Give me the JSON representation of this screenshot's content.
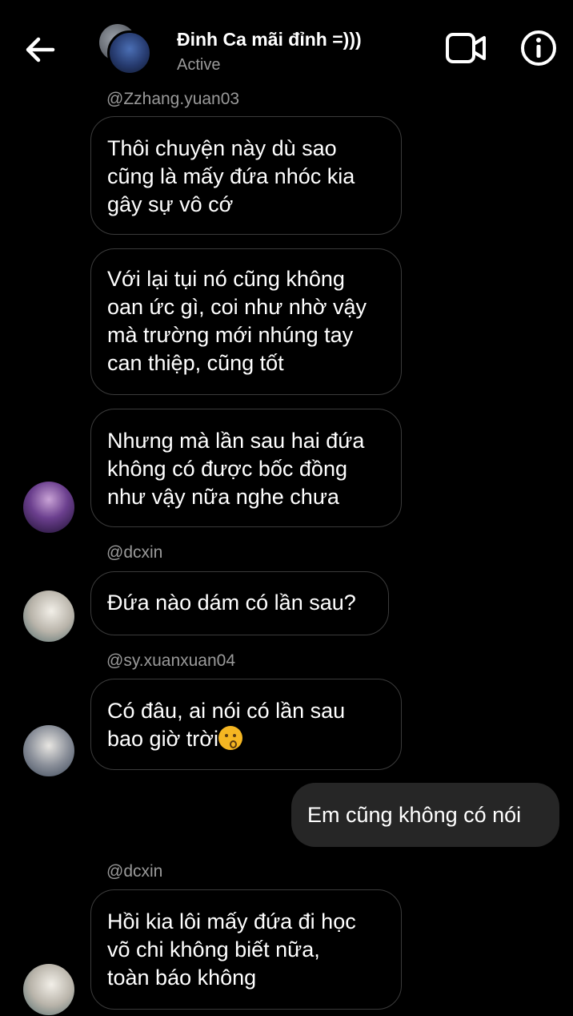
{
  "header": {
    "title": "Đinh Ca mãi đỉnh =)))",
    "status": "Active",
    "back_icon": "arrow-left-icon",
    "video_icon": "video-camera-icon",
    "info_icon": "info-circle-icon"
  },
  "messages": [
    {
      "sender": "@Zzhang.yuan03"
    },
    {
      "text": "Thôi chuyện này dù sao\ncũng là mấy đứa nhóc kia\ngây sự vô cớ"
    },
    {
      "text": "Với lại tụi nó cũng không\noan ức gì, coi như nhờ vậy\nmà trường mới nhúng tay\ncan thiệp, cũng tốt"
    },
    {
      "text": "Nhưng mà lần sau hai đứa\nkhông có được bốc đồng\nnhư vậy nữa nghe chưa"
    },
    {
      "sender": "@dcxin"
    },
    {
      "text": "Đứa nào dám có lần sau?"
    },
    {
      "sender": "@sy.xuanxuan04"
    },
    {
      "text": "Có đâu, ai nói có lần sau\nbao giờ trời",
      "emoji": "kissing-face-emoji"
    },
    {
      "text": "Em cũng không có nói"
    },
    {
      "sender": "@dcxin"
    },
    {
      "text": "Hồi kia lôi mấy đứa đi học\nvõ chi không biết nữa,\ntoàn báo không"
    }
  ]
}
